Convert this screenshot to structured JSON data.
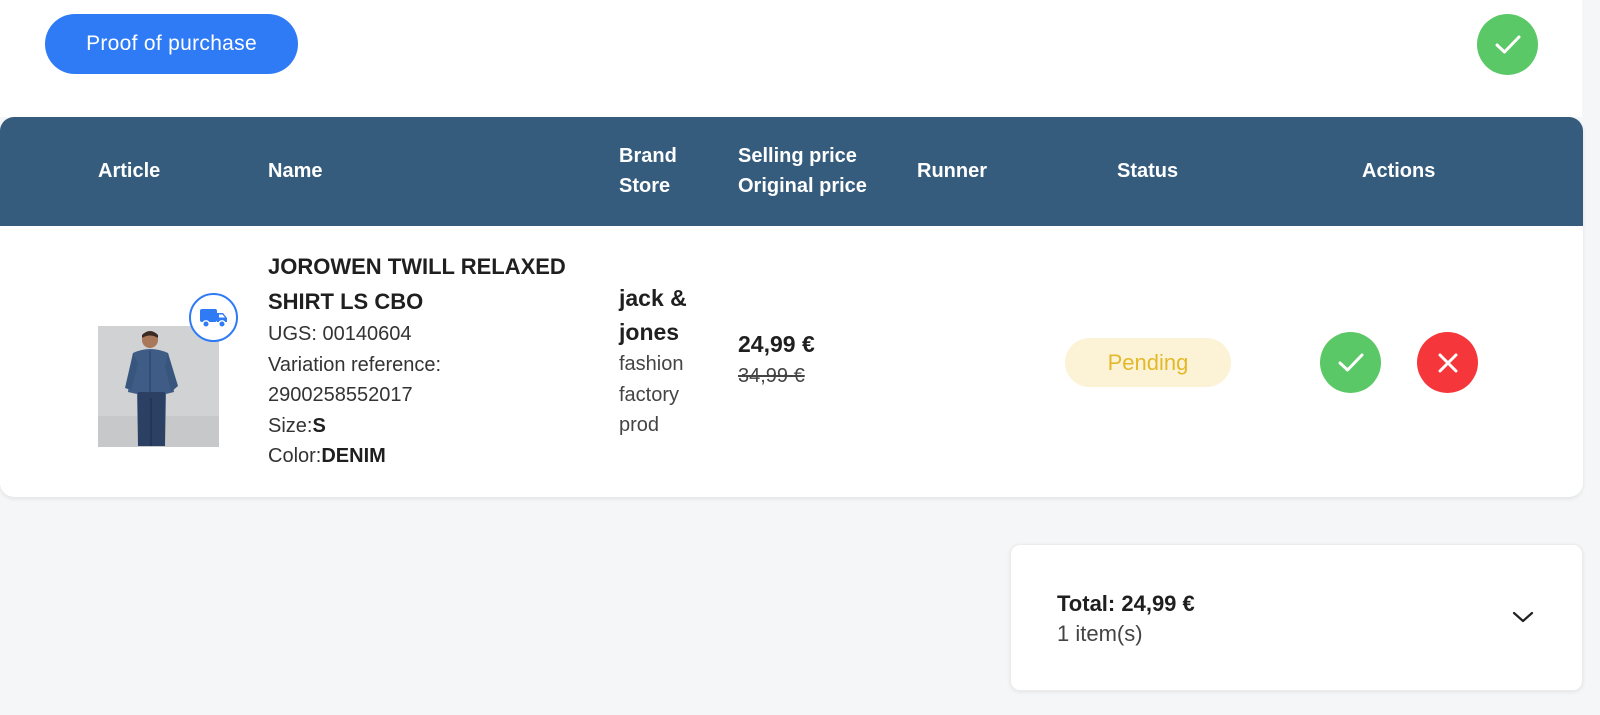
{
  "header": {
    "proof_button_label": "Proof of purchase",
    "confirm_icon": "check-icon",
    "colors": {
      "primary": "#2f7bf5",
      "success": "#5ac866",
      "danger": "#f5363a",
      "table_header": "#365c7d"
    }
  },
  "table": {
    "columns": {
      "article": "Article",
      "name": "Name",
      "brand": "Brand",
      "store": "Store",
      "selling_price": "Selling price",
      "original_price": "Original price",
      "runner": "Runner",
      "status": "Status",
      "actions": "Actions"
    },
    "rows": [
      {
        "image_icon": "product-photo",
        "delivery_icon": "truck-icon",
        "title": "JOROWEN TWILL RELAXED SHIRT LS CBO",
        "ugs": "UGS: 00140604",
        "variation_label": "Variation reference:",
        "variation_value": "2900258552017",
        "size_label": "Size:",
        "size_value": "S",
        "color_label": "Color:",
        "color_value": "DENIM",
        "brand": "jack & jones",
        "store": "fashion factory prod",
        "selling_price": "24,99 €",
        "original_price": "34,99 €",
        "runner": "",
        "status": "Pending"
      }
    ]
  },
  "summary": {
    "total": "Total: 24,99 €",
    "items": "1 item(s)",
    "expand_icon": "chevron-down-icon"
  }
}
